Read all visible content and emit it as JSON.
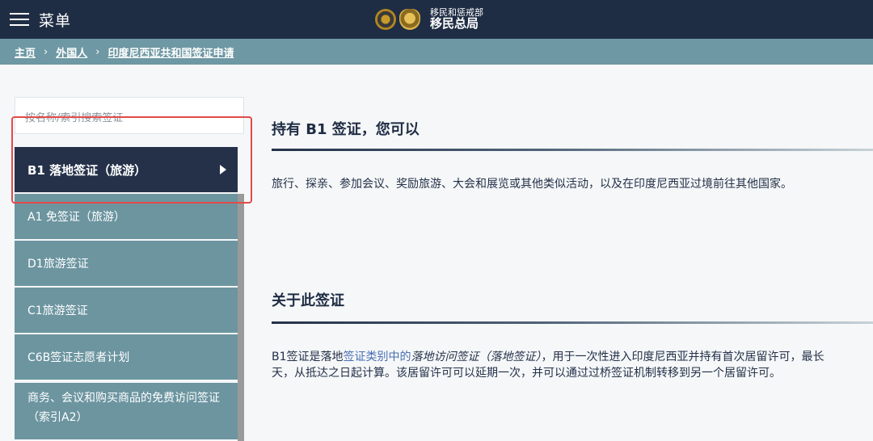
{
  "header": {
    "menu_label": "菜单",
    "org_line1": "移民和惩戒部",
    "org_line2": "移民总局"
  },
  "breadcrumb": [
    "主页",
    "外国人",
    "印度尼西亚共和国签证申请"
  ],
  "search": {
    "placeholder": "按名称/索引搜索签证"
  },
  "sidebar": {
    "items": [
      {
        "label": "B1 落地签证（旅游）",
        "active": true
      },
      {
        "label": "A1 免签证（旅游）"
      },
      {
        "label": "D1旅游签证"
      },
      {
        "label": "C1旅游签证"
      },
      {
        "label": "C6B签证志愿者计划"
      },
      {
        "label": "商务、会议和购买商品的免费访问签证（索引A2）"
      }
    ]
  },
  "main": {
    "section1_title": "持有 B1 签证，您可以",
    "section1_text": "旅行、探亲、参加会议、奖励旅游、大会和展览或其他类似活动，以及在印度尼西亚过境前往其他国家。",
    "section2_title": "关于此签证",
    "section2_text_a": "B1签证是落地",
    "section2_link": "签证类别中的",
    "section2_italic": "落地访问签证（落地签证）",
    "section2_text_b": "，用于一次性进入印度尼西亚并持有首次居留许可，最长",
    "section2_text_c": "天，从抵达之日起计算。该居留许可可以延期一次，并可以通过过桥签证机制转移到另一个居留许可。"
  },
  "colors": {
    "topbar": "#1f2d44",
    "breadcrumb_bar": "#6e98a3",
    "active_item": "#243149",
    "inactive_item": "#6c95a0",
    "highlight_outline": "#e34a4a",
    "link": "#4a6fb3"
  }
}
